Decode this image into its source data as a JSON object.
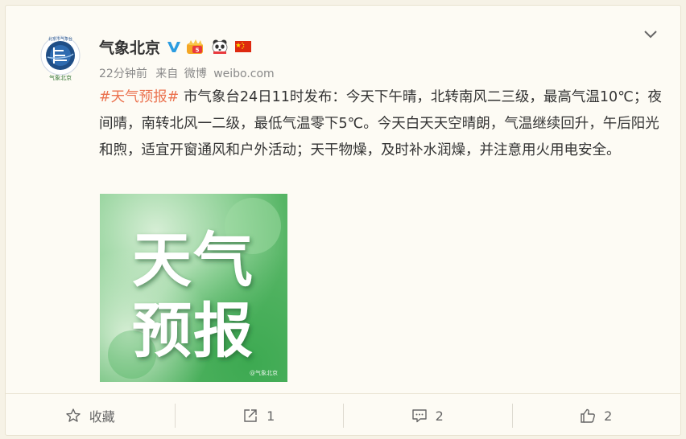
{
  "post": {
    "author": "气象北京",
    "time_ago": "22分钟前",
    "source_prefix": "来自",
    "source_app": "微博",
    "source_domain": "weibo.com",
    "hashtag": "#天气预报#",
    "text": " 市气象台24日11时发布：今天下午晴，北转南风二三级，最高气温10℃；夜间晴，南转北风一二级，最低气温零下5℃。今天白天天空晴朗，气温继续回升，午后阳光和煦，适宜开窗通风和户外活动；天干物燥，及时补水润燥，并注意用火用电安全。",
    "image": {
      "line1": "天气",
      "line2": "预报",
      "watermark": "@气象北京"
    },
    "avatar_text_top": "北京市气象台",
    "avatar_text_bottom": "气象北京"
  },
  "actions": [
    {
      "icon": "star-icon",
      "label": "收藏"
    },
    {
      "icon": "share-icon",
      "label": "1"
    },
    {
      "icon": "comment-icon",
      "label": "2"
    },
    {
      "icon": "like-icon",
      "label": "2"
    }
  ],
  "colors": {
    "hashtag": "#eb7350",
    "verified": "#2b9ce0",
    "background": "#f6f2e6"
  }
}
